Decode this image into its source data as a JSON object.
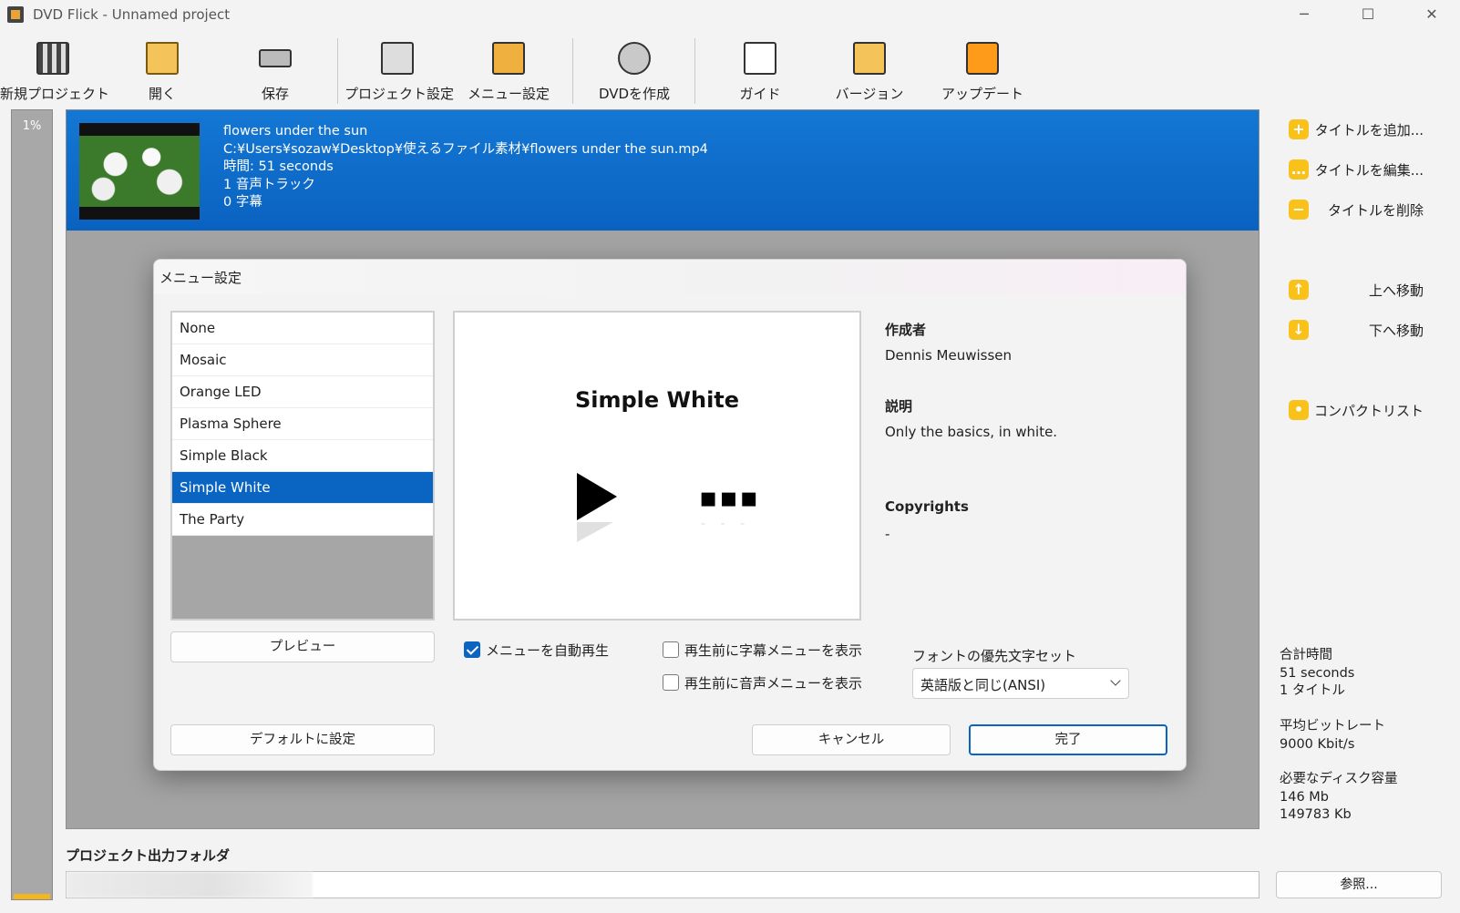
{
  "window": {
    "title": "DVD Flick - Unnamed project",
    "min": "─",
    "max": "☐",
    "close": "✕"
  },
  "toolbar": {
    "new_project": "新規プロジェクト",
    "open": "開く",
    "save": "保存",
    "project_settings": "プロジェクト設定",
    "menu_settings": "メニュー設定",
    "create_dvd": "DVDを作成",
    "guide": "ガイド",
    "version": "バージョン",
    "update": "アップデート"
  },
  "progress": {
    "percent_label": "1%",
    "value": 0.01
  },
  "title_item": {
    "name": "flowers under the sun",
    "path": "C:¥Users¥sozaw¥Desktop¥使えるファイル素材¥flowers under the sun.mp4",
    "duration": "時間: 51 seconds",
    "audio_tracks": "1 音声トラック",
    "subtitles": "0 字幕"
  },
  "sidebar": {
    "add_title": "タイトルを追加...",
    "edit_title": "タイトルを編集...",
    "remove_title": "タイトルを削除",
    "move_up": "上へ移動",
    "move_down": "下へ移動",
    "compact_list": "コンパクトリスト",
    "total_time_label": "合計時間",
    "total_time_value": "51 seconds",
    "title_count": "1 タイトル",
    "avg_bitrate_label": "平均ビットレート",
    "avg_bitrate_value": "9000 Kbit/s",
    "disk_label": "必要なディスク容量",
    "disk_mb": "146 Mb",
    "disk_kb": "149783 Kb"
  },
  "output": {
    "label": "プロジェクト出力フォルダ",
    "browse": "参照..."
  },
  "dialog": {
    "title": "メニュー設定",
    "themes": [
      "None",
      "Mosaic",
      "Orange LED",
      "Plasma Sphere",
      "Simple Black",
      "Simple White",
      "The Party"
    ],
    "selected_theme": "Simple White",
    "preview_title": "Simple White",
    "preview_dots": "▪▪▪",
    "preview_dots_refl": "- - -",
    "author_label": "作成者",
    "author_value": "Dennis Meuwissen",
    "desc_label": "説明",
    "desc_value": "Only the basics, in white.",
    "copyright_label": "Copyrights",
    "copyright_value": "-",
    "preview_button": "プレビュー",
    "autoplay_label": "メニューを自動再生",
    "autoplay_checked": true,
    "subtitle_menu_label": "再生前に字幕メニューを表示",
    "audio_menu_label": "再生前に音声メニューを表示",
    "font_charset_label": "フォントの優先文字セット",
    "font_charset_value": "英語版と同じ(ANSI)",
    "default_button": "デフォルトに設定",
    "cancel_button": "キャンセル",
    "ok_button": "完了"
  },
  "colors": {
    "accent": "#0a64c2",
    "title_bar_blue": "#1477d4",
    "icon_yellow": "#f8c21b"
  }
}
